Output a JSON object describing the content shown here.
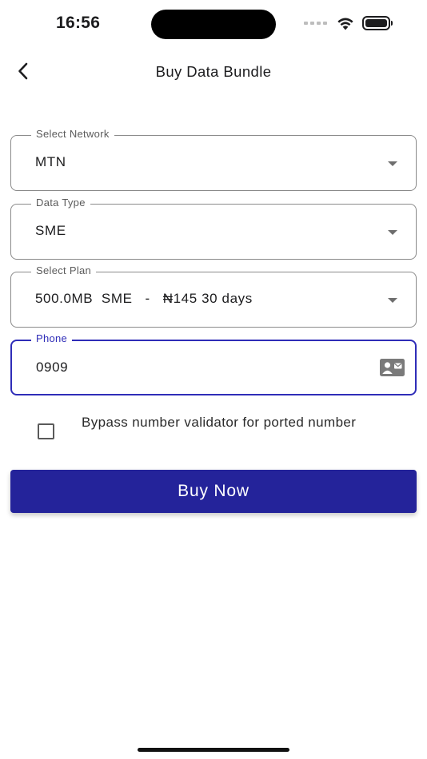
{
  "status_bar": {
    "time": "16:56"
  },
  "header": {
    "title": "Buy Data Bundle",
    "back_icon": "chevron-left-icon"
  },
  "form": {
    "network": {
      "label": "Select Network",
      "value": "MTN"
    },
    "data_type": {
      "label": "Data Type",
      "value": "SME"
    },
    "plan": {
      "label": "Select Plan",
      "value": "500.0MB  SME   -   ₦145 30 days"
    },
    "phone": {
      "label": "Phone",
      "value": "0909",
      "icon": "contact-card-icon"
    },
    "bypass": {
      "label": "Bypass number validator for ported number",
      "checked": false
    }
  },
  "actions": {
    "buy_label": "Buy Now"
  },
  "colors": {
    "primary": "#24239a",
    "focus": "#2f2db8",
    "border": "#8a8a8a"
  }
}
